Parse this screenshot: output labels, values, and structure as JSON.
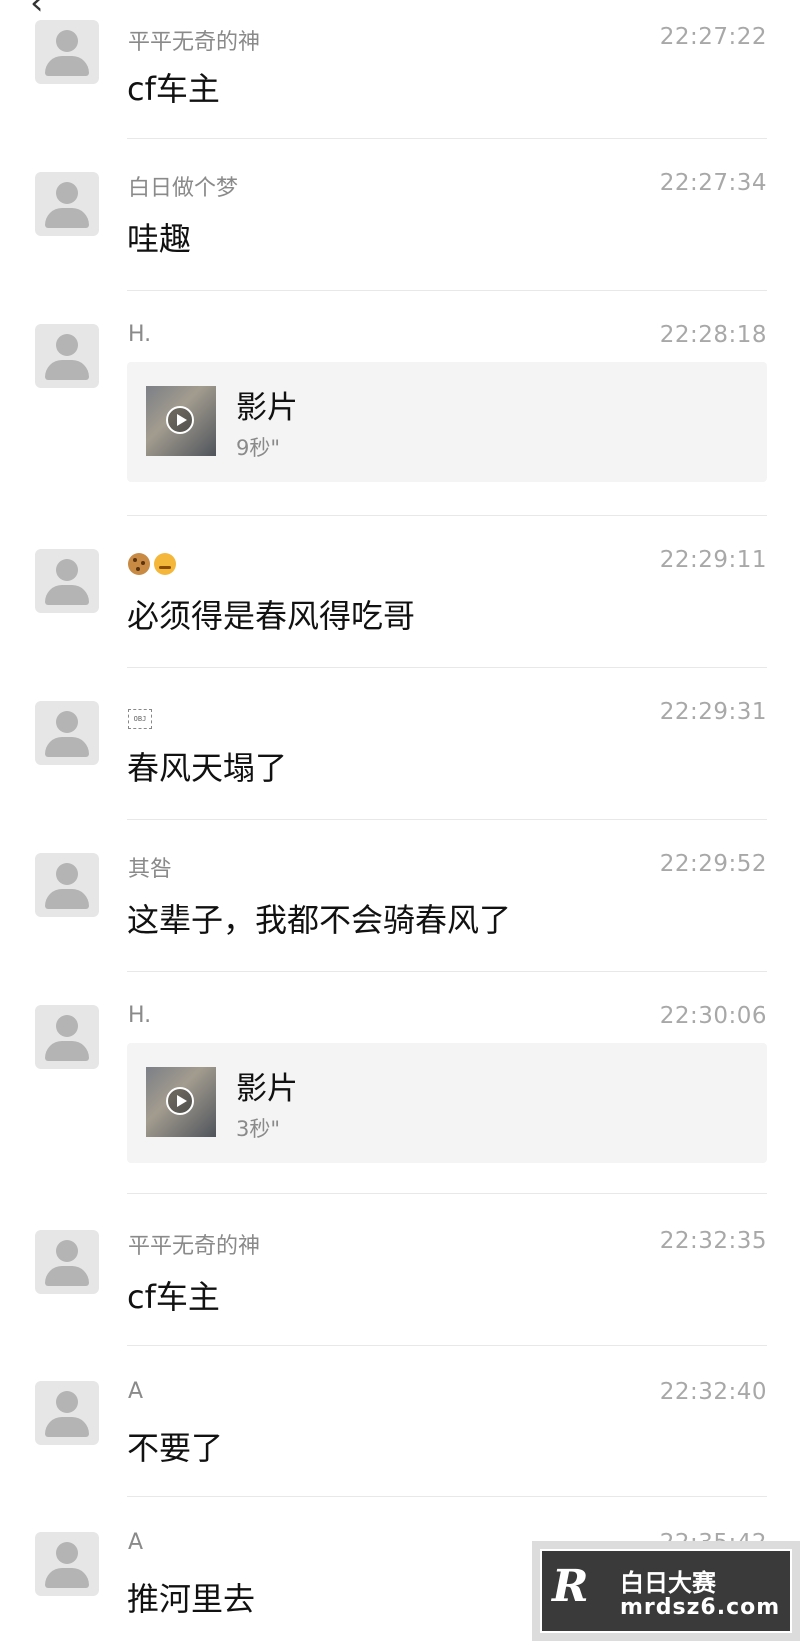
{
  "header": {
    "back_icon": "chevron-left-icon"
  },
  "messages": [
    {
      "name": "平平无奇的神",
      "time": "22:27:22",
      "text": "cf车主"
    },
    {
      "name": "白日做个梦",
      "time": "22:27:34",
      "text": "哇趣"
    },
    {
      "name": "H.",
      "time": "22:28:18",
      "video": {
        "title": "影片",
        "duration": "9秒\""
      }
    },
    {
      "name_emoji": [
        "cookie-emoji",
        "angry-face-emoji"
      ],
      "time": "22:29:11",
      "text": "必须得是春风得吃哥"
    },
    {
      "name_obj": "OBJ",
      "time": "22:29:31",
      "text": "春风天塌了"
    },
    {
      "name": "其咎",
      "time": "22:29:52",
      "text": "这辈子，我都不会骑春风了"
    },
    {
      "name": "H.",
      "time": "22:30:06",
      "video": {
        "title": "影片",
        "duration": "3秒\""
      }
    },
    {
      "name": "平平无奇的神",
      "time": "22:32:35",
      "text": "cf车主"
    },
    {
      "name": "A",
      "time": "22:32:40",
      "text": "不要了"
    },
    {
      "name": "A",
      "time": "22:35:42",
      "text": "推河里去"
    }
  ],
  "watermark": {
    "logo": "R",
    "title": "白日大赛",
    "url": "mrdsz6.com"
  }
}
